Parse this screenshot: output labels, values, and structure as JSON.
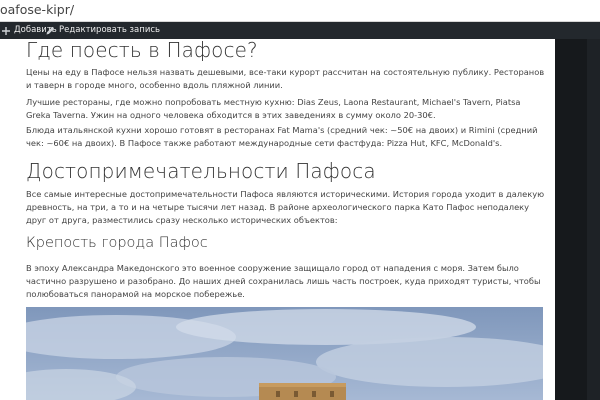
{
  "browser": {
    "url": "oafose-kipr/"
  },
  "admin_bar": {
    "add_label": "Добавить",
    "add_icon": "plus-icon",
    "edit_label": "Редактировать запись",
    "edit_icon": "pencil-icon"
  },
  "article": {
    "sections": [
      {
        "heading": "Где поесть в Пафосе?",
        "paragraphs": [
          "Цены на еду в Пафосе нельзя назвать дешевыми, все-таки курорт рассчитан на состоятельную публику. Ресторанов и таверн в городе много, особенно вдоль пляжной линии.",
          "Лучшие рестораны, где можно попробовать местную кухню: Dias Zeus, Laona Restaurant, Michael's Tavern, Piatsa Greka Taverna. Ужин на одного человека обходится в этих заведениях в сумму около 20-30€.",
          "Блюда итальянской кухни хорошо готовят в ресторанах Fat Mama's (средний чек: ~50€ на двоих) и Rimini (средний чек: ~60€ на двоих). В Пафосе также работают международные сети фастфуда: Pizza Hut, KFC, McDonald's."
        ]
      },
      {
        "heading": "Достопримечательности Пафоса",
        "paragraphs": [
          "Все самые интересные достопримечательности Пафоса являются историческими. История города уходит в далекую древность, на три, а то и на четыре тысячи лет назад. В районе археологического парка Като Пафос неподалеку друг от друга, разместились сразу несколько исторических объектов:"
        ]
      }
    ],
    "subsection": {
      "heading": "Крепость города Пафос",
      "paragraph": "В эпоху Александра Македонского это военное сооружение защищало город от нападения с моря. Затем было частично разрушено и разобрано. До наших дней сохранилась лишь часть построек, куда приходят туристы, чтобы полюбоваться панорамой на морское побережье."
    }
  },
  "colors": {
    "admin_bar_bg": "#23282d",
    "heading_text": "#333333",
    "body_text": "#444444",
    "sky": "#8fa6c6"
  }
}
